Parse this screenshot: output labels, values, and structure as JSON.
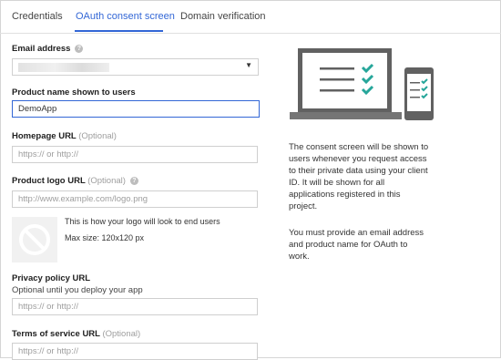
{
  "tabs": [
    {
      "label": "Credentials"
    },
    {
      "label": "OAuth consent screen"
    },
    {
      "label": "Domain verification"
    }
  ],
  "active_tab": "OAuth consent screen",
  "form": {
    "email": {
      "label": "Email address",
      "help_icon": "help-icon"
    },
    "product_name": {
      "label": "Product name shown to users",
      "value": "DemoApp"
    },
    "homepage": {
      "label": "Homepage URL",
      "optional": "(Optional)",
      "placeholder": "https:// or http://"
    },
    "logo_url": {
      "label": "Product logo URL",
      "optional": "(Optional)",
      "placeholder": "http://www.example.com/logo.png",
      "help_icon": "help-icon"
    },
    "logo_preview": {
      "line1": "This is how your logo will look to end users",
      "line2": "Max size: 120x120 px",
      "icon": "no-image-icon"
    },
    "privacy": {
      "label": "Privacy policy URL",
      "sublabel": "Optional until you deploy your app",
      "placeholder": "https:// or http://"
    },
    "terms": {
      "label": "Terms of service URL",
      "optional": "(Optional)",
      "placeholder": "https:// or http://"
    }
  },
  "info": {
    "paragraph1": [
      "The consent screen will be shown to",
      "users whenever you request access",
      "to their private data using your client",
      "ID. It will be shown for all",
      "applications registered in this",
      "project."
    ],
    "paragraph2": [
      "You must provide an email address",
      "and product name for OAuth to",
      "work."
    ],
    "illustration": "laptop-and-phone-checklist-illustration"
  },
  "colors": {
    "accent": "#3367d6",
    "check": "#26a69a",
    "device": "#616161"
  }
}
